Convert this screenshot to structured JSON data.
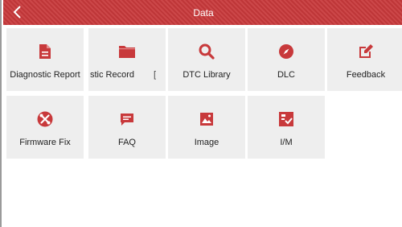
{
  "header": {
    "title": "Data",
    "back_icon": "chevron-left-icon",
    "color": "#c8393b"
  },
  "tiles": [
    {
      "label": "Diagnostic Report",
      "icon": "document-icon"
    },
    {
      "label": "stic Record",
      "trail": "[",
      "icon": "folder-icon"
    },
    {
      "label": "DTC Library",
      "icon": "search-icon"
    },
    {
      "label": "DLC",
      "icon": "compass-icon"
    },
    {
      "label": "Feedback",
      "icon": "edit-icon"
    },
    {
      "label": "Firmware Fix",
      "icon": "tools-icon"
    },
    {
      "label": "FAQ",
      "icon": "chat-icon"
    },
    {
      "label": "Image",
      "icon": "image-icon"
    },
    {
      "label": "I/M",
      "icon": "inspection-icon"
    }
  ],
  "accent": "#c8393b",
  "tile_bg": "#eeeeee"
}
